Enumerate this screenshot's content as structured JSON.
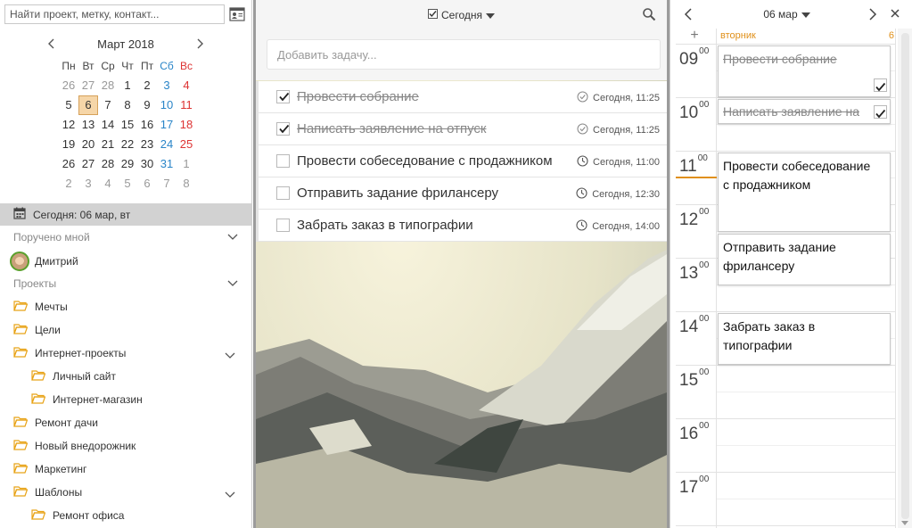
{
  "sidebar": {
    "search_placeholder": "Найти проект, метку, контакт...",
    "contacts_icon": "contacts-card-icon",
    "calendar": {
      "month_title": "Март 2018",
      "weekdays": [
        "Пн",
        "Вт",
        "Ср",
        "Чт",
        "Пт",
        "Сб",
        "Вс"
      ],
      "weeks": [
        [
          "26",
          "27",
          "28",
          "1",
          "2",
          "3",
          "4"
        ],
        [
          "5",
          "6",
          "7",
          "8",
          "9",
          "10",
          "11"
        ],
        [
          "12",
          "13",
          "14",
          "15",
          "16",
          "17",
          "18"
        ],
        [
          "19",
          "20",
          "21",
          "22",
          "23",
          "24",
          "25"
        ],
        [
          "26",
          "27",
          "28",
          "29",
          "30",
          "31",
          "1"
        ],
        [
          "2",
          "3",
          "4",
          "5",
          "6",
          "7",
          "8"
        ]
      ],
      "today": "6"
    },
    "today_label": "Сегодня: 06 мар, вт",
    "assigned_by_me": "Поручено мной",
    "person_name": "Дмитрий",
    "projects_label": "Проекты",
    "projects": {
      "p1": "Мечты",
      "p2": "Цели",
      "p3": "Интернет-проекты",
      "p3_1": "Личный сайт",
      "p3_2": "Интернет-магазин",
      "p4": "Ремонт дачи",
      "p5": "Новый внедорожник",
      "p6": "Маркетинг",
      "p7": "Шаблоны",
      "p7_1": "Ремонт офиса"
    }
  },
  "main": {
    "filter_label": "Сегодня",
    "add_task_placeholder": "Добавить задачу...",
    "tasks": [
      {
        "title": "Провести собрание",
        "due": "Сегодня, 11:25",
        "done": true
      },
      {
        "title": "Написать заявление на отпуск",
        "due": "Сегодня, 11:25",
        "done": true
      },
      {
        "title": "Провести собеседование с продажником",
        "due": "Сегодня, 11:00",
        "done": false
      },
      {
        "title": "Отправить задание фрилансеру",
        "due": "Сегодня, 12:30",
        "done": false
      },
      {
        "title": "Забрать заказ в типографии",
        "due": "Сегодня, 14:00",
        "done": false
      }
    ]
  },
  "day_view": {
    "date_title": "06 мар",
    "add_symbol": "+",
    "weekday": "вторник",
    "day_number": "6",
    "hours": [
      "09",
      "10",
      "11",
      "12",
      "13",
      "14",
      "15",
      "16",
      "17"
    ],
    "minutes": "00",
    "events": {
      "e1": "Провести собрание",
      "e2": "Написать заявление на",
      "e3_line1": "Провести собеседование",
      "e3_line2": "с продажником",
      "e4_line1": "Отправить задание",
      "e4_line2": "фрилансеру",
      "e5_line1": "Забрать заказ в",
      "e5_line2": "типографии"
    }
  },
  "colors": {
    "accent_orange": "#e0901a",
    "sat_blue": "#2a85c8",
    "sun_red": "#d33",
    "today_bar": "#d2d2d2",
    "folder": "#e8a317",
    "avatar_ring": "#5aa02c"
  }
}
